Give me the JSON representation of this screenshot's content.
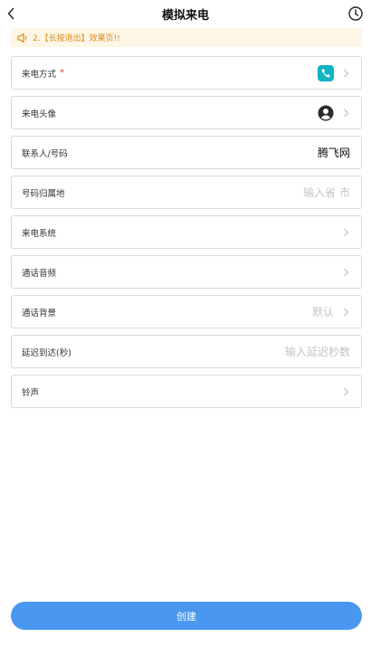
{
  "header": {
    "title": "模拟来电"
  },
  "notice": {
    "text": "2.【长按退出】效果页!!",
    "color": "#d98b1b"
  },
  "form": {
    "rows": [
      {
        "label": "来电方式",
        "required_mark": "*",
        "icon": "phone-icon"
      },
      {
        "label": "来电头像",
        "icon": "avatar-icon"
      },
      {
        "label": "联系人/号码",
        "value": "腾飞网"
      },
      {
        "label": "号码归属地",
        "placeholder": "输入省 市"
      },
      {
        "label": "来电系统"
      },
      {
        "label": "通话音频"
      },
      {
        "label": "通话背景",
        "placeholder": "默认"
      },
      {
        "label": "延迟到达(秒)",
        "placeholder": "输入延迟秒数"
      },
      {
        "label": "铃声"
      }
    ]
  },
  "footer": {
    "create_label": "创建",
    "accent": "#4a97f0"
  }
}
